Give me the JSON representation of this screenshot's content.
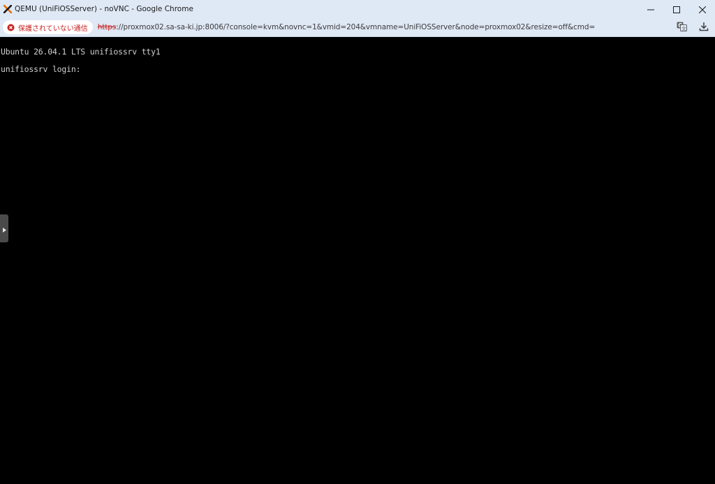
{
  "window": {
    "title": "QEMU (UniFiOSServer) - noVNC - Google Chrome",
    "icon": "proxmox-x-icon",
    "controls": {
      "minimize_icon": "minimize-icon",
      "maximize_icon": "maximize-icon",
      "close_icon": "close-icon"
    }
  },
  "addressbar": {
    "security_label": "保護されていない通信",
    "security_icon": "not-secure-icon",
    "url_scheme": "https",
    "url_rest": "://proxmox02.sa-sa-ki.jp:8006/?console=kvm&novnc=1&vmid=204&vmname=UniFiOSServer&node=proxmox02&resize=off&cmd=",
    "actions": [
      "translate-icon",
      "download-icon"
    ]
  },
  "console": {
    "lines": [
      "Ubuntu 26.04.1 LTS unifiossrv tty1",
      "unifiossrv login: "
    ],
    "handle_icon": "expand-control-bar-icon"
  },
  "colors": {
    "titlebar_bg": "#dfe8f5",
    "console_bg": "#000000",
    "console_text": "#d0d0d0",
    "warning_red": "#c5221f",
    "proxmox_orange": "#e57000"
  }
}
